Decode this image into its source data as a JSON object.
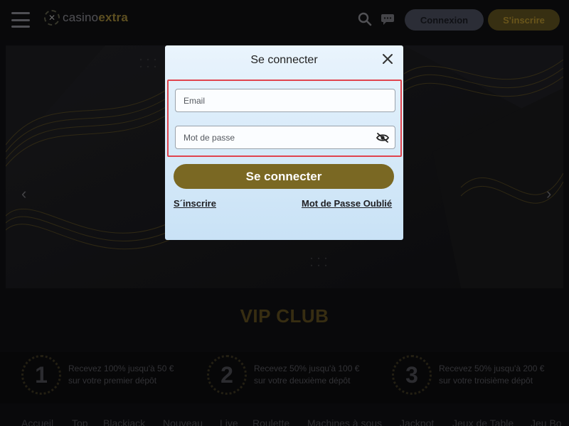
{
  "header": {
    "logo_prefix": "casino",
    "logo_suffix": "extra",
    "login_label": "Connexion",
    "signup_label": "S'inscrire",
    "icons": [
      "menu-icon",
      "search-icon",
      "chat-icon"
    ]
  },
  "hero": {
    "prev_arrow": "‹",
    "next_arrow": "›"
  },
  "vip": {
    "title": "VIP CLUB",
    "steps": [
      {
        "number": "1",
        "line1": "Recevez 100% jusqu'à 50 €",
        "line2": "sur votre premier dépôt"
      },
      {
        "number": "2",
        "line1": "Recevez 50% jusqu'à 100 €",
        "line2": "sur votre deuxième dépôt"
      },
      {
        "number": "3",
        "line1": "Recevez 50% jusqu'à 200 €",
        "line2": "sur votre troisième dépôt"
      }
    ]
  },
  "nav": [
    "Accueil",
    "Top",
    "Blackjack",
    "Nouveau",
    "Live",
    "Roulette",
    "Machines à sous",
    "Jackpot",
    "Jeux de Table",
    "Jeu Bo"
  ],
  "modal": {
    "title": "Se connecter",
    "email_placeholder": "Email",
    "password_placeholder": "Mot de passe",
    "submit_label": "Se connecter",
    "signup_link": "S´inscrire",
    "forgot_link": "Mot de Passe Oublié"
  },
  "colors": {
    "accent_gold": "#7a6823",
    "highlight_border": "#e0444e",
    "login_button": "#3a3d48"
  }
}
